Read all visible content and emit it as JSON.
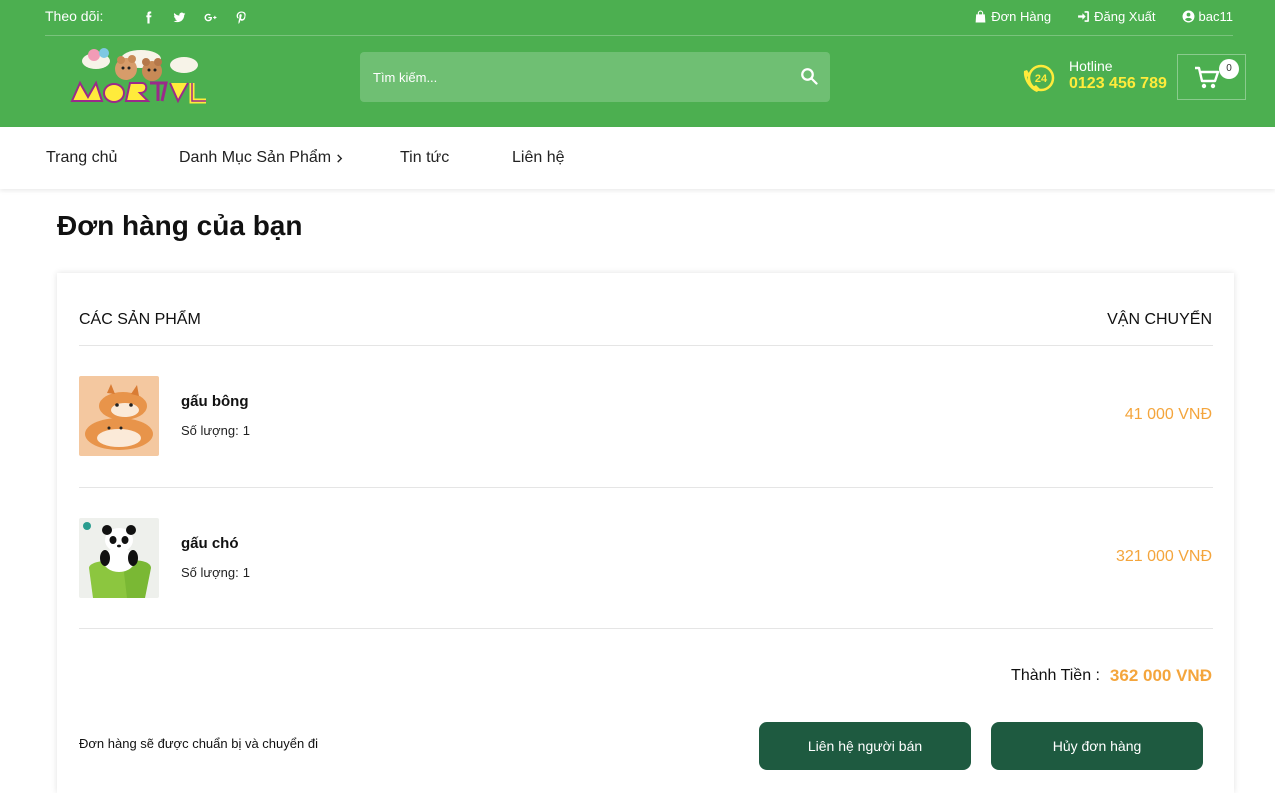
{
  "topbar": {
    "follow_label": "Theo dõi:",
    "socials": [
      "facebook-icon",
      "twitter-icon",
      "google-plus-icon",
      "pinterest-icon"
    ],
    "orders_label": "Đơn Hàng",
    "logout_label": "Đăng Xuất",
    "username": "bac11"
  },
  "header": {
    "search_placeholder": "Tìm kiếm...",
    "hotline_label": "Hotline",
    "hotline_number": "0123 456 789",
    "hotline_badge": "24",
    "cart_count": "0",
    "logo_text": "",
    "colors": {
      "primary": "#4caf50",
      "accent": "#ffeb3b",
      "button": "#1e5a40",
      "price": "#f4a53c"
    }
  },
  "nav": {
    "items": [
      "Trang chủ",
      "Danh Mục Sản Phẩm",
      "Tin tức",
      "Liên hệ"
    ]
  },
  "page": {
    "title": "Đơn hàng của bạn"
  },
  "order": {
    "col_products": "CÁC SẢN PHẨM",
    "col_shipping": "VẬN CHUYỂN",
    "qty_label": "Số lượng:",
    "items": [
      {
        "name": "gấu bông",
        "qty": "1",
        "price": "41 000 VNĐ"
      },
      {
        "name": "gấu chó",
        "qty": "1",
        "price": "321 000 VNĐ"
      }
    ],
    "total_label": "Thành Tiền :",
    "total_value": "362 000 VNĐ",
    "note": "Đơn hàng sẽ được chuẩn bị và chuyển đi",
    "contact_button": "Liên hệ người bán",
    "cancel_button": "Hủy đơn hàng"
  }
}
